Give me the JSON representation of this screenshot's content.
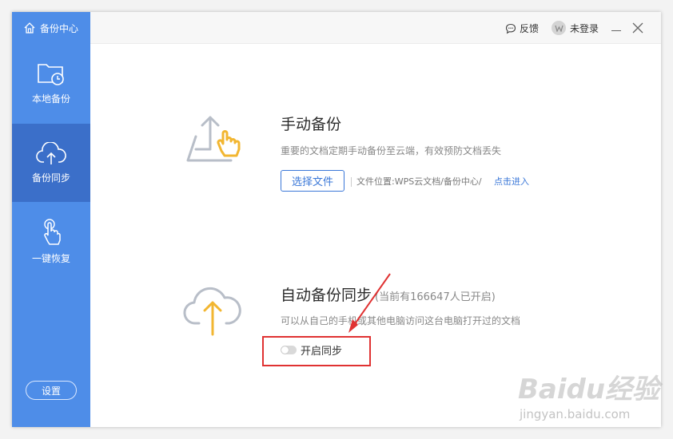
{
  "app": {
    "title": "备份中心"
  },
  "sidebar": {
    "items": [
      {
        "label": "本地备份",
        "icon": "folder-clock-icon"
      },
      {
        "label": "备份同步",
        "icon": "cloud-upload-icon"
      },
      {
        "label": "一键恢复",
        "icon": "hand-pointer-icon"
      }
    ],
    "active": 1,
    "settings_label": "设置"
  },
  "titlebar": {
    "feedback_label": "反馈",
    "login_label": "未登录"
  },
  "manual": {
    "title": "手动备份",
    "desc": "重要的文档定期手动备份至云端，有效预防文档丢失",
    "button_label": "选择文件",
    "location_text": "文件位置:WPS云文档/备份中心/",
    "link_label": "点击进入"
  },
  "auto": {
    "title": "自动备份同步",
    "count_text": "(当前有166647人已开启)",
    "desc": "可以从自己的手机或其他电脑访问这台电脑打开过的文档",
    "toggle_label": "开启同步",
    "toggle_on": false
  },
  "watermark": {
    "brand": "Baidu经验",
    "url": "jingyan.baidu.com"
  },
  "colors": {
    "sidebar": "#4e8de8",
    "sidebar_active": "#3b6fc9",
    "accent": "#3b78d8",
    "highlight": "#e03232"
  }
}
